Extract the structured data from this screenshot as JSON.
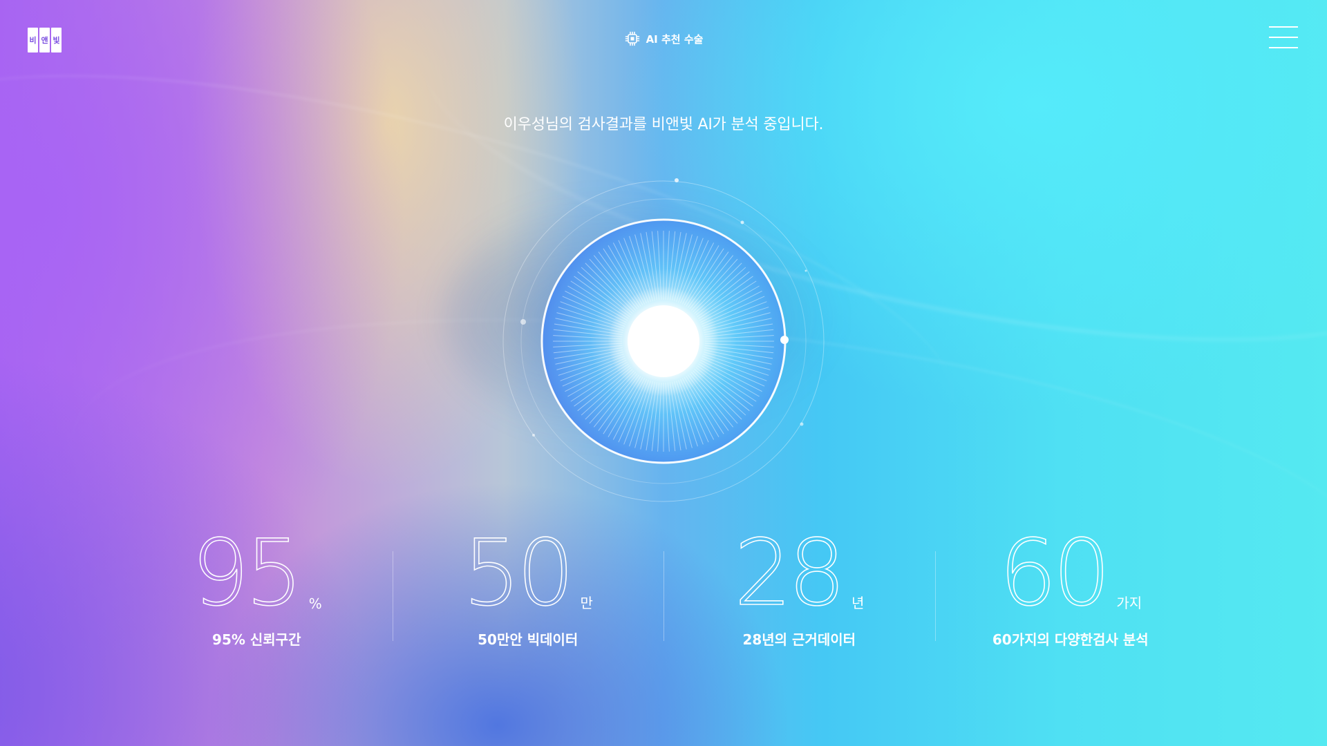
{
  "header": {
    "logo_chars": [
      "비",
      "앤",
      "빛"
    ],
    "ai_label": "AI 추천 수술"
  },
  "headline": "이우성님의 검사결과를 비앤빛 AI가 분석 중입니다.",
  "stats": [
    {
      "value": "95",
      "unit": "%",
      "caption": "95% 신뢰구간"
    },
    {
      "value": "50",
      "unit": "만",
      "caption": "50만안 빅데이터"
    },
    {
      "value": "28",
      "unit": "년",
      "caption": "28년의 근거데이터"
    },
    {
      "value": "60",
      "unit": "가지",
      "caption": "60가지의 다양한검사 분석"
    }
  ],
  "colors": {
    "logo_text": "#7b4fe0",
    "accent_cyan": "#55e9f1",
    "accent_purple": "#a765ef"
  },
  "icons": {
    "ai": "chip-icon",
    "menu": "hamburger-icon"
  }
}
